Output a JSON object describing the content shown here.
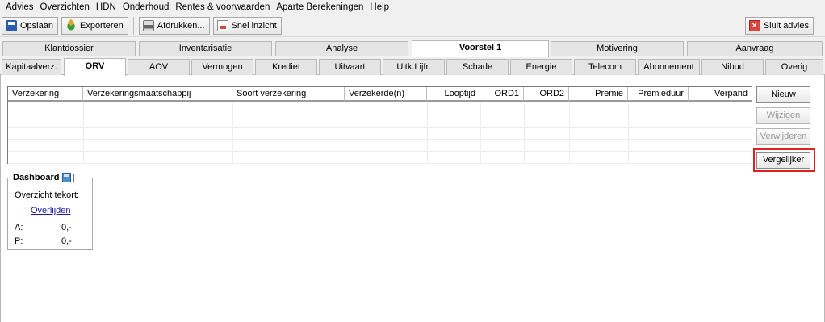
{
  "menu": [
    "Advies",
    "Overzichten",
    "HDN",
    "Onderhoud",
    "Rentes & voorwaarden",
    "Aparte Berekeningen",
    "Help"
  ],
  "toolbar": {
    "save": "Opslaan",
    "export": "Exporteren",
    "print": "Afdrukken...",
    "quick_view": "Snel inzicht",
    "close_advice": "Sluit advies"
  },
  "main_tabs": [
    "Klantdossier",
    "Inventarisatie",
    "Analyse",
    "Voorstel 1",
    "Motivering",
    "Aanvraag"
  ],
  "main_tabs_active": "Voorstel 1",
  "sub_tabs": [
    "Kapitaalverz.",
    "ORV",
    "AOV",
    "Vermogen",
    "Krediet",
    "Uitvaart",
    "Uitk.Lijfr.",
    "Schade",
    "Energie",
    "Telecom",
    "Abonnement",
    "Nibud",
    "Overig"
  ],
  "sub_tabs_active": "ORV",
  "grid": {
    "columns": [
      "Verzekering",
      "Verzekeringsmaatschappij",
      "Soort verzekering",
      "Verzekerde(n)",
      "Looptijd",
      "ORD1",
      "ORD2",
      "Premie",
      "Premieduur",
      "Verpand"
    ],
    "rows": []
  },
  "side_buttons": {
    "new": "Nieuw",
    "edit": "Wijzigen",
    "delete": "Verwijderen",
    "compare": "Vergelijker"
  },
  "dashboard": {
    "title": "Dashboard",
    "subtitle": "Overzicht tekort:",
    "link": "Overlijden",
    "a_label": "A:",
    "a_value": "0,-",
    "p_label": "P:",
    "p_value": "0,-"
  },
  "colors": {
    "highlight": "#e0201c",
    "link": "#1a1aa6",
    "background": "#f0f0f0"
  }
}
